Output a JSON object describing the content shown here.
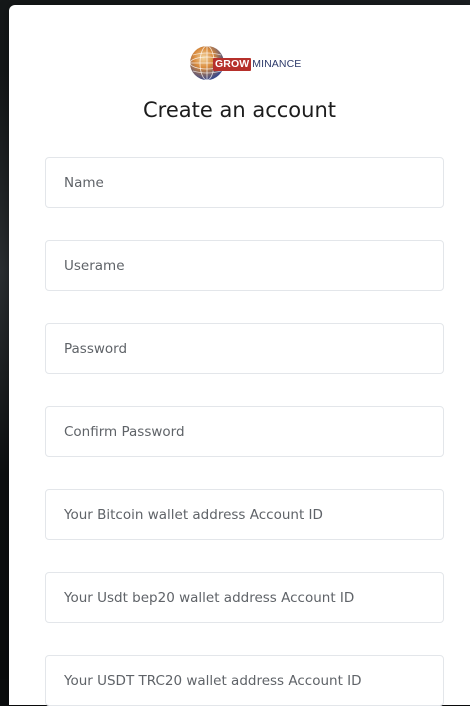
{
  "brand": {
    "name_part1": "GROW",
    "name_part2": "MINANCE"
  },
  "form": {
    "title": "Create an account",
    "fields": [
      {
        "placeholder": "Name",
        "value": ""
      },
      {
        "placeholder": "Userame",
        "value": ""
      },
      {
        "placeholder": "Password",
        "value": ""
      },
      {
        "placeholder": "Confirm Password",
        "value": ""
      },
      {
        "placeholder": "Your Bitcoin wallet address Account ID",
        "value": ""
      },
      {
        "placeholder": "Your Usdt bep20 wallet address Account ID",
        "value": ""
      },
      {
        "placeholder": "Your USDT TRC20 wallet address Account ID",
        "value": ""
      }
    ]
  },
  "colors": {
    "brand_red": "#b6302b",
    "brand_navy": "#2d3a6a",
    "field_border": "#e3e6ea"
  }
}
